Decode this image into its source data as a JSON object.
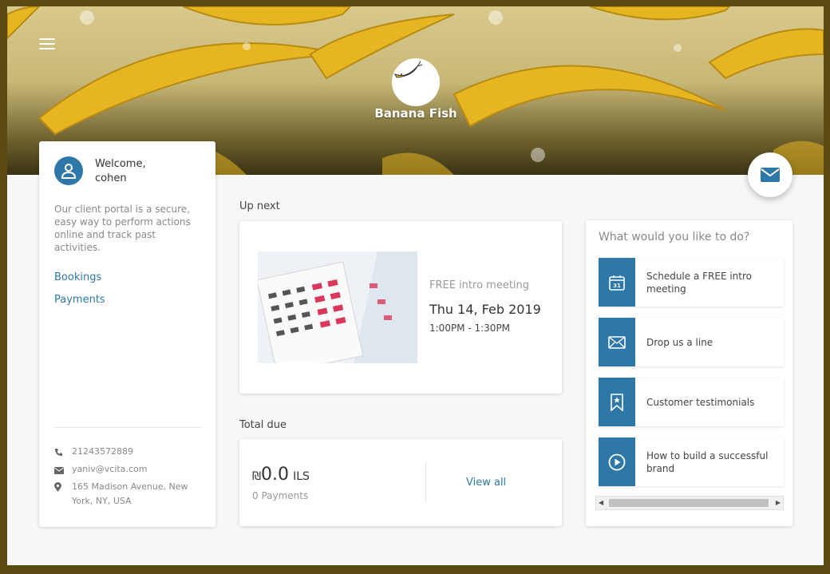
{
  "header": {
    "brand_name": "Banana Fish",
    "menu_icon": "hamburger-menu-icon",
    "logo_icon": "banana-fish-logo",
    "banner_color": "#c8b877",
    "accent_color": "#2d78a8"
  },
  "sidebar": {
    "welcome_line1": "Welcome,",
    "welcome_line2": "cohen",
    "intro": "Our client portal is a secure, easy way to perform actions online and track past activities.",
    "nav": [
      {
        "label": "Bookings"
      },
      {
        "label": "Payments"
      }
    ],
    "contact": {
      "phone": "21243572889",
      "email": "yaniv@vcita.com",
      "address": "165 Madison Avenue, New York, NY, USA"
    }
  },
  "upnext": {
    "label": "Up next",
    "meeting_type": "FREE intro meeting",
    "date": "Thu 14, Feb 2019",
    "time": "1:00PM - 1:30PM"
  },
  "total_due": {
    "label": "Total due",
    "currency_symbol": "₪",
    "amount": "0.0",
    "currency_code": "ILS",
    "payments": "0 Payments",
    "view_all": "View all"
  },
  "actions": {
    "title": "What would you like to do?",
    "items": [
      {
        "label": "Schedule a FREE intro meeting",
        "icon": "calendar-icon"
      },
      {
        "label": "Drop us a line",
        "icon": "envelope-icon"
      },
      {
        "label": "Customer testimonials",
        "icon": "badge-star-icon"
      },
      {
        "label": "How to build a successful brand",
        "icon": "play-icon"
      }
    ]
  }
}
